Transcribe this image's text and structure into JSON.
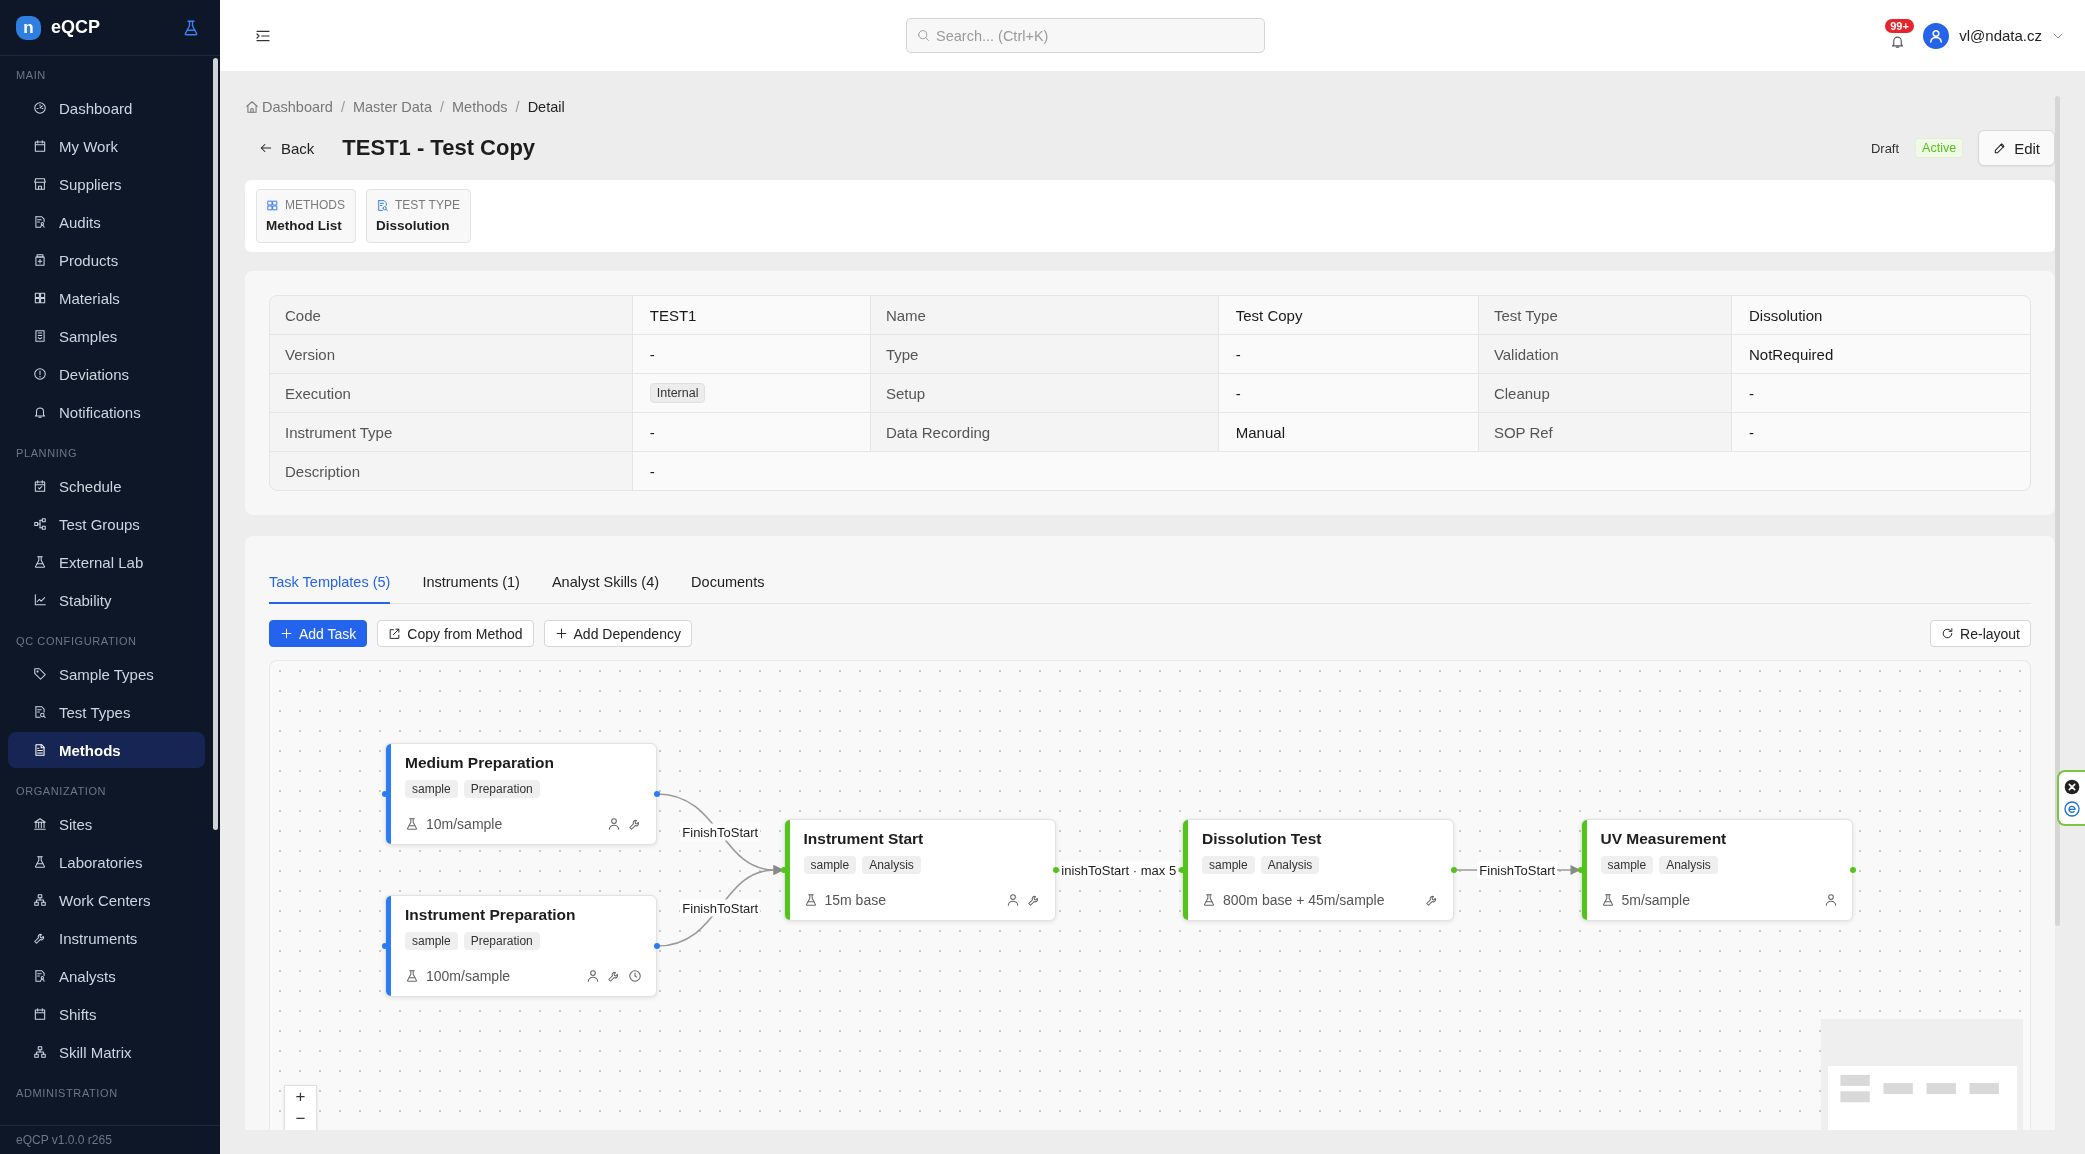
{
  "brand": {
    "mark": "n",
    "name": "eQCP"
  },
  "sidebar": {
    "sections": [
      {
        "title": "MAIN",
        "items": [
          {
            "label": "Dashboard",
            "selected": false
          },
          {
            "label": "My Work",
            "selected": false
          },
          {
            "label": "Suppliers",
            "selected": false
          },
          {
            "label": "Audits",
            "selected": false
          },
          {
            "label": "Products",
            "selected": false
          },
          {
            "label": "Materials",
            "selected": false
          },
          {
            "label": "Samples",
            "selected": false
          },
          {
            "label": "Deviations",
            "selected": false
          },
          {
            "label": "Notifications",
            "selected": false
          }
        ]
      },
      {
        "title": "PLANNING",
        "items": [
          {
            "label": "Schedule",
            "selected": false
          },
          {
            "label": "Test Groups",
            "selected": false
          },
          {
            "label": "External Lab",
            "selected": false
          },
          {
            "label": "Stability",
            "selected": false
          }
        ]
      },
      {
        "title": "QC CONFIGURATION",
        "items": [
          {
            "label": "Sample Types",
            "selected": false
          },
          {
            "label": "Test Types",
            "selected": false
          },
          {
            "label": "Methods",
            "selected": true
          }
        ]
      },
      {
        "title": "ORGANIZATION",
        "items": [
          {
            "label": "Sites",
            "selected": false
          },
          {
            "label": "Laboratories",
            "selected": false
          },
          {
            "label": "Work Centers",
            "selected": false
          },
          {
            "label": "Instruments",
            "selected": false
          },
          {
            "label": "Analysts",
            "selected": false
          },
          {
            "label": "Shifts",
            "selected": false
          },
          {
            "label": "Skill Matrix",
            "selected": false
          }
        ]
      },
      {
        "title": "ADMINISTRATION"
      }
    ],
    "version": "eQCP v1.0.0 r265"
  },
  "header": {
    "search": {
      "placeholder": "Search... (Ctrl+K)"
    },
    "notification_count": "99+",
    "user": "vl@ndata.cz"
  },
  "breadcrumb": [
    {
      "label": "Dashboard",
      "separator": "/"
    },
    {
      "label": "Master Data",
      "separator": "/"
    },
    {
      "label": "Methods",
      "separator": "/"
    },
    {
      "label": "Detail"
    }
  ],
  "page": {
    "back": "Back",
    "title": "TEST1 - Test Copy",
    "statuses": [
      {
        "label": "Draft",
        "kind": "plain"
      },
      {
        "label": "Active",
        "kind": "success"
      }
    ],
    "edit": "Edit"
  },
  "context_tiles": [
    {
      "caption": "METHODS",
      "value": "Method List"
    },
    {
      "caption": "TEST TYPE",
      "value": "Dissolution"
    }
  ],
  "details": {
    "rows": [
      [
        {
          "label": "Code",
          "value": "TEST1",
          "kind": "text"
        },
        {
          "label": "Name",
          "value": "Test Copy",
          "kind": "text"
        },
        {
          "label": "Test Type",
          "value": "Dissolution",
          "kind": "text"
        }
      ],
      [
        {
          "label": "Version",
          "value": "-",
          "kind": "text"
        },
        {
          "label": "Type",
          "value": "-",
          "kind": "text"
        },
        {
          "label": "Validation",
          "value": "NotRequired",
          "kind": "text"
        }
      ],
      [
        {
          "label": "Execution",
          "value": "Internal",
          "kind": "tag"
        },
        {
          "label": "Setup",
          "value": "-",
          "kind": "text"
        },
        {
          "label": "Cleanup",
          "value": "-",
          "kind": "text"
        }
      ],
      [
        {
          "label": "Instrument Type",
          "value": "-",
          "kind": "text"
        },
        {
          "label": "Data Recording",
          "value": "Manual",
          "kind": "text"
        },
        {
          "label": "SOP Ref",
          "value": "-",
          "kind": "text"
        }
      ],
      [
        {
          "label": "Description",
          "value": "-",
          "kind": "text"
        }
      ]
    ]
  },
  "tabs": [
    {
      "label": "Task Templates (5)",
      "selected": true
    },
    {
      "label": "Instruments (1)",
      "selected": false
    },
    {
      "label": "Analyst Skills (4)",
      "selected": false
    },
    {
      "label": "Documents",
      "selected": false
    }
  ],
  "toolbar": {
    "actions": [
      {
        "label": "Add Task",
        "kind": "primary"
      },
      {
        "label": "Copy from Method",
        "kind": "secondary"
      },
      {
        "label": "Add Dependency",
        "kind": "secondary"
      }
    ],
    "relayout": "Re-layout"
  },
  "flow": {
    "stages": [
      {
        "tasks": [
          {
            "name": "Medium Preparation",
            "tags": [
              "sample",
              "Preparation"
            ],
            "duration": "10m/sample",
            "color": "#2b7bf3",
            "requires_analyst": true,
            "requires_instrument": true,
            "time_constraint": false,
            "link_label": "FinishToStart"
          },
          {
            "name": "Instrument Preparation",
            "tags": [
              "sample",
              "Preparation"
            ],
            "duration": "100m/sample",
            "color": "#2b7bf3",
            "requires_analyst": true,
            "requires_instrument": true,
            "time_constraint": true,
            "link_label": "FinishToStart"
          }
        ]
      },
      {
        "tasks": [
          {
            "name": "Instrument Start",
            "tags": [
              "sample",
              "Analysis"
            ],
            "duration": "15m base",
            "color": "#52c41a",
            "requires_analyst": true,
            "requires_instrument": true,
            "time_constraint": false,
            "link_label": "inishToStart · max 5"
          }
        ]
      },
      {
        "tasks": [
          {
            "name": "Dissolution Test",
            "tags": [
              "sample",
              "Analysis"
            ],
            "duration": "800m base + 45m/sample",
            "color": "#52c41a",
            "requires_analyst": false,
            "requires_instrument": true,
            "time_constraint": false,
            "link_label": "FinishToStart"
          }
        ]
      },
      {
        "tasks": [
          {
            "name": "UV Measurement",
            "tags": [
              "sample",
              "Analysis"
            ],
            "duration": "5m/sample",
            "color": "#52c41a",
            "requires_analyst": true,
            "requires_instrument": false,
            "time_constraint": false
          }
        ]
      }
    ],
    "zoom_controls": [
      "+",
      "−"
    ]
  }
}
